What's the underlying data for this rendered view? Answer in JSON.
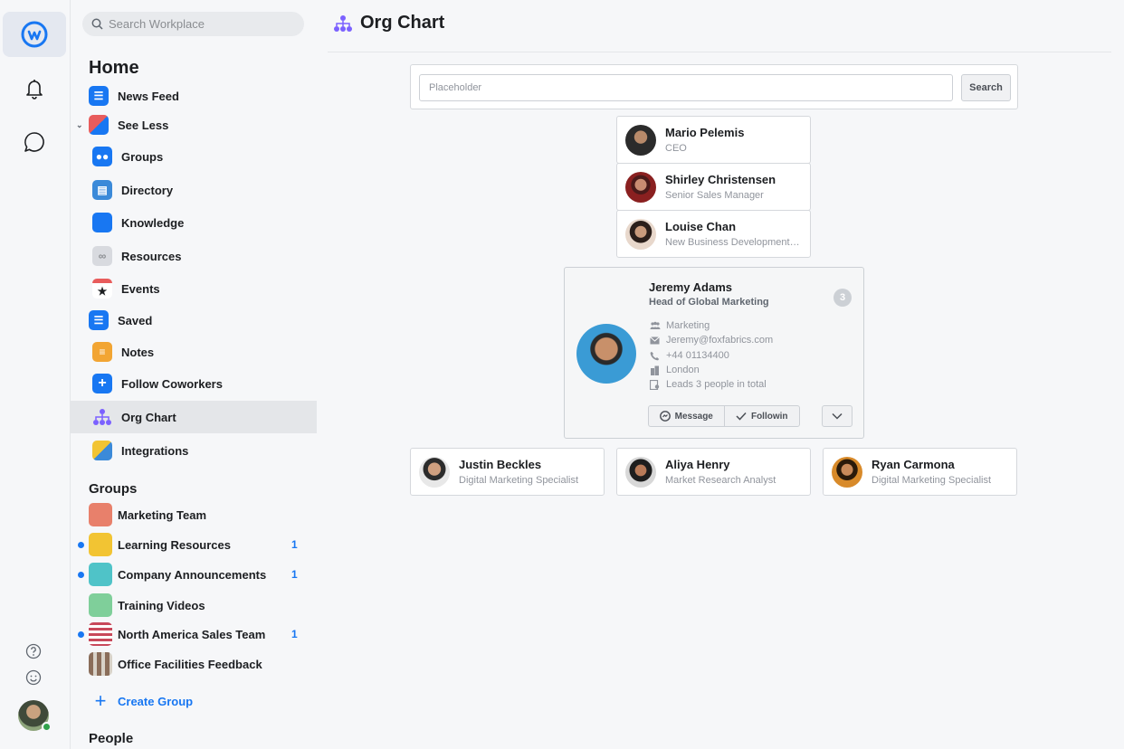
{
  "sidebar": {
    "search_placeholder": "Search Workplace",
    "home_heading": "Home",
    "nav": [
      {
        "label": "News Feed",
        "icon": "news-feed-icon",
        "color": "#1877f2"
      },
      {
        "label": "See Less",
        "icon": "see-less-icon",
        "color": "#e85c5c"
      },
      {
        "label": "Groups",
        "icon": "groups-icon",
        "color": "#1877f2"
      },
      {
        "label": "Directory",
        "icon": "directory-icon",
        "color": "#3b8ad9"
      },
      {
        "label": "Knowledge",
        "icon": "knowledge-icon",
        "color": "#1877f2"
      },
      {
        "label": "Resources",
        "icon": "link-icon",
        "color": "#b0b3b8"
      },
      {
        "label": "Events",
        "icon": "calendar-icon",
        "color": "#e85c5c"
      },
      {
        "label": "Saved",
        "icon": "saved-icon",
        "color": "#1877f2"
      },
      {
        "label": "Notes",
        "icon": "notes-icon",
        "color": "#f2a533"
      },
      {
        "label": "Follow Coworkers",
        "icon": "follow-coworkers-icon",
        "color": "#1877f2"
      },
      {
        "label": "Org Chart",
        "icon": "org-chart-icon",
        "color": "#7b61ff"
      },
      {
        "label": "Integrations",
        "icon": "integrations-icon",
        "color": "#f2c433"
      }
    ],
    "groups_heading": "Groups",
    "groups": [
      {
        "label": "Marketing Team",
        "count": "",
        "unread": false,
        "color": "#e8806b"
      },
      {
        "label": "Learning Resources",
        "count": "1",
        "unread": true,
        "color": "#f2c433"
      },
      {
        "label": "Company Announcements",
        "count": "1",
        "unread": true,
        "color": "#4fc3c8"
      },
      {
        "label": "Training Videos",
        "count": "",
        "unread": false,
        "color": "#7fcf9a"
      },
      {
        "label": "North America Sales Team",
        "count": "1",
        "unread": true,
        "color": "#c8485a"
      },
      {
        "label": "Office Facilities Feedback",
        "count": "",
        "unread": false,
        "color": "#8a6d5a"
      }
    ],
    "create_group": "Create Group",
    "people_heading": "People"
  },
  "main": {
    "title": "Org Chart",
    "search": {
      "placeholder": "Placeholder",
      "button": "Search"
    },
    "chain": [
      {
        "name": "Mario Pelemis",
        "role": "CEO"
      },
      {
        "name": "Shirley Christensen",
        "role": "Senior Sales Manager"
      },
      {
        "name": "Louise Chan",
        "role": "New Business Development Manager"
      }
    ],
    "focus": {
      "name": "Jeremy Adams",
      "title": "Head of Global Marketing",
      "reports_badge": "3",
      "details": [
        {
          "icon": "team-icon",
          "text": "Marketing"
        },
        {
          "icon": "email-icon",
          "text": "Jeremy@foxfabrics.com"
        },
        {
          "icon": "phone-icon",
          "text": "+44 01134400"
        },
        {
          "icon": "building-icon",
          "text": "London"
        },
        {
          "icon": "reports-icon",
          "text": "Leads 3 people in total"
        }
      ],
      "message_label": "Message",
      "following_label": "Followin"
    },
    "reports": [
      {
        "name": "Justin Beckles",
        "role": "Digital Marketing Specialist"
      },
      {
        "name": "Aliya Henry",
        "role": "Market Research Analyst"
      },
      {
        "name": "Ryan Carmona",
        "role": "Digital Marketing Specialist"
      }
    ]
  },
  "colors": {
    "accent": "#1877f2",
    "brand": "#1877f2",
    "online": "#31a24c"
  }
}
